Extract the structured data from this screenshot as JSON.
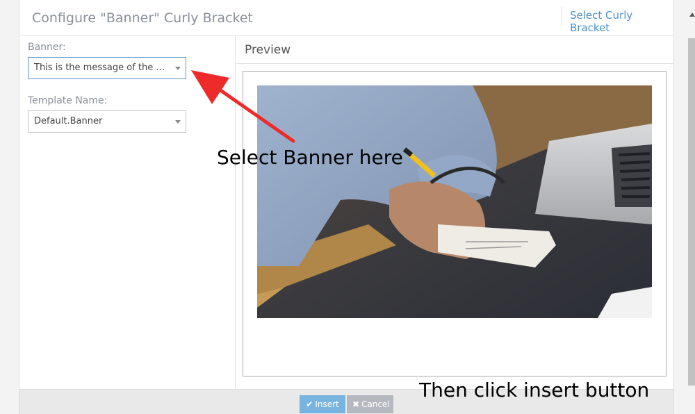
{
  "dialog": {
    "title": "Configure \"Banner\" Curly Bracket",
    "header_link": "Select Curly Bracket"
  },
  "form": {
    "banner_label": "Banner:",
    "banner_value": "This is the message of the ban...",
    "template_label": "Template Name:",
    "template_value": "Default.Banner"
  },
  "preview": {
    "title": "Preview"
  },
  "footer": {
    "insert_label": "Insert",
    "insert_icon": "check-icon",
    "cancel_label": "Cancel",
    "cancel_icon": "x-icon"
  },
  "annotations": {
    "select_banner": "Select Banner here",
    "click_insert": "Then click insert button",
    "arrow_color": "#ee2b2b"
  },
  "colors": {
    "accent": "#4d8fc8",
    "insert_button": "#79b3e0",
    "cancel_button": "#b5b9bf"
  }
}
